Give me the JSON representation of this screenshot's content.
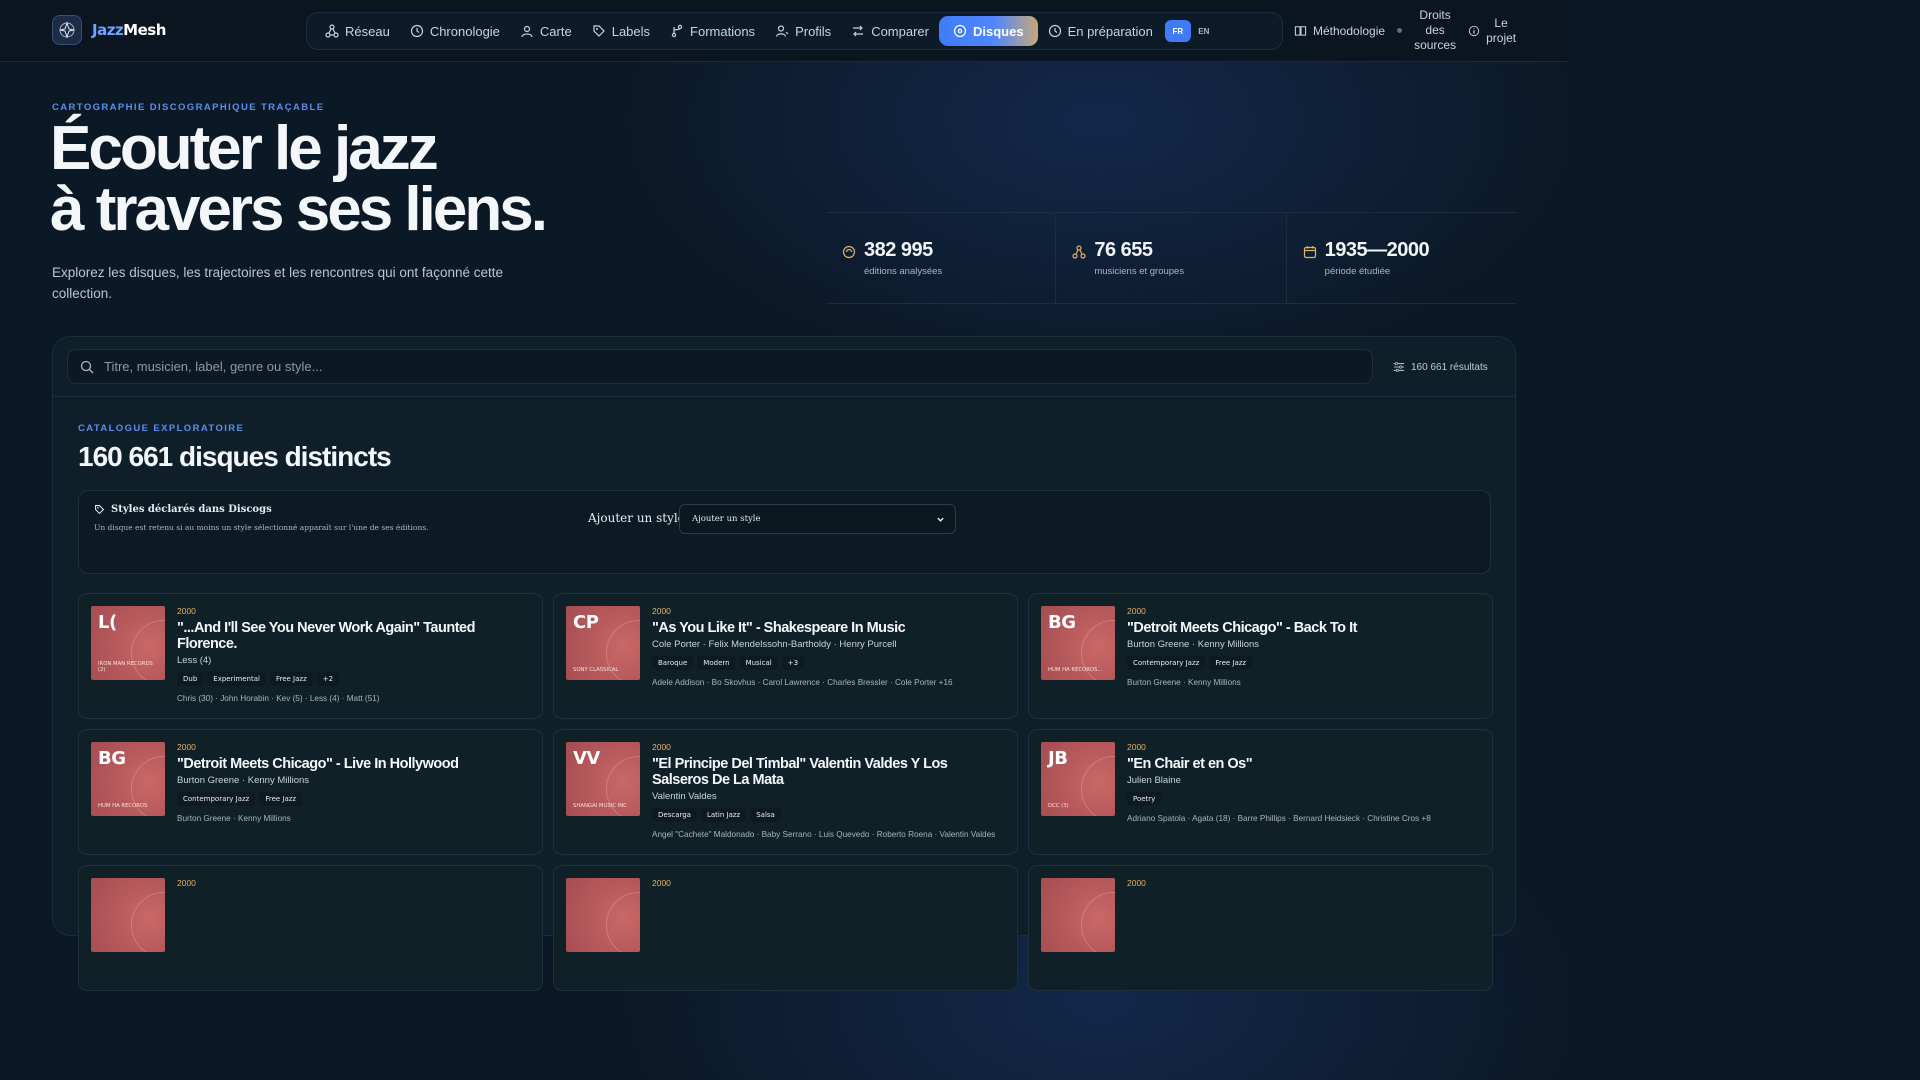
{
  "brand": {
    "name_a": "Jazz",
    "name_b": "Mesh"
  },
  "nav": {
    "items": [
      {
        "label": "Réseau",
        "icon": "network-icon"
      },
      {
        "label": "Chronologie",
        "icon": "clock-icon"
      },
      {
        "label": "Carte",
        "icon": "map-pin-icon"
      },
      {
        "label": "Labels",
        "icon": "tag-icon"
      },
      {
        "label": "Formations",
        "icon": "branch-icon"
      },
      {
        "label": "Profils",
        "icon": "user-icon"
      },
      {
        "label": "Comparer",
        "icon": "swap-icon"
      },
      {
        "label": "Disques",
        "icon": "disc-icon",
        "active": true
      },
      {
        "label": "En préparation",
        "icon": "clock-icon"
      }
    ],
    "lang_fr": "FR",
    "lang_en": "EN",
    "methodology": "Méthodologie",
    "rights": [
      "Droits",
      "des",
      "sources"
    ],
    "project": [
      "Le",
      "projet"
    ]
  },
  "hero": {
    "eyebrow": "CARTOGRAPHIE DISCOGRAPHIQUE TRAÇABLE",
    "title_line1": "Écouter le jazz",
    "title_line2": "à travers ses liens.",
    "subtitle": "Explorez les disques, les trajectoires et les rencontres qui ont façonné cette collection."
  },
  "stats": [
    {
      "value": "382 995",
      "label": "éditions analysées",
      "icon": "disc-icon"
    },
    {
      "value": "76 655",
      "label": "musiciens et groupes",
      "icon": "network-icon"
    },
    {
      "value": "1935—2000",
      "label": "période étudiée",
      "icon": "calendar-icon"
    }
  ],
  "search": {
    "placeholder": "Titre, musicien, label, genre ou style...",
    "results": "160 661 résultats"
  },
  "catalog": {
    "eyebrow": "CATALOGUE EXPLORATOIRE",
    "title": "160 661 disques distincts"
  },
  "filter": {
    "heading": "Styles déclarés dans Discogs",
    "description": "Un disque est retenu si au moins un style sélectionné apparaît sur l'une de ses éditions.",
    "label": "Ajouter un style",
    "selected": "Ajouter un style"
  },
  "cards": [
    {
      "initials": "L(",
      "label": "IRON MAN RECORDS (2)",
      "year": "2000",
      "title": "\"...And I'll See You Never Work Again\" Taunted Florence.",
      "artist": "Less (4)",
      "tags": [
        "Dub",
        "Experimental",
        "Free Jazz",
        "+2"
      ],
      "people": "Chris (30) · John Horabin · Kev (5) · Less (4) · Matt (51)"
    },
    {
      "initials": "CP",
      "label": "SONY CLASSICAL",
      "year": "2000",
      "title": "\"As You Like It\" - Shakespeare In Music",
      "artist": "Cole Porter · Felix Mendelssohn-Bartholdy · Henry Purcell",
      "tags": [
        "Baroque",
        "Modern",
        "Musical",
        "+3"
      ],
      "people": "Adele Addison · Bo Skovhus · Carol Lawrence · Charles Bressler · Cole Porter +16"
    },
    {
      "initials": "BG",
      "label": "HUM HA RECORDS...",
      "year": "2000",
      "title": "\"Detroit Meets Chicago\" - Back To It",
      "artist": "Burton Greene · Kenny Millions",
      "tags": [
        "Contemporary Jazz",
        "Free Jazz"
      ],
      "people": "Burton Greene · Kenny Millions"
    },
    {
      "initials": "BG",
      "label": "HUM HA RECORDS",
      "year": "2000",
      "title": "\"Detroit Meets Chicago\" - Live In Hollywood",
      "artist": "Burton Greene · Kenny Millions",
      "tags": [
        "Contemporary Jazz",
        "Free Jazz"
      ],
      "people": "Burton Greene · Kenny Millions"
    },
    {
      "initials": "VV",
      "label": "SHANGAI MUSIC INC",
      "year": "2000",
      "title": "\"El Principe Del Timbal\" Valentin Valdes Y Los Salseros De La Mata",
      "artist": "Valentin Valdes",
      "tags": [
        "Descarga",
        "Latin Jazz",
        "Salsa"
      ],
      "people": "Angel \"Cachete\" Maldonado · Baby Serrano · Luis Quevedo · Roberto Roena · Valentin Valdes"
    },
    {
      "initials": "JB",
      "label": "DCC (3)",
      "year": "2000",
      "title": "\"En Chair et en Os\"",
      "artist": "Julien Blaine",
      "tags": [
        "Poetry"
      ],
      "people": "Adriano Spatola · Agata (18) · Barre Phillips · Bernard Heidsieck · Christine Cros +8"
    },
    {
      "initials": "",
      "label": "",
      "year": "2000",
      "title": "",
      "artist": "",
      "tags": [],
      "people": ""
    },
    {
      "initials": "",
      "label": "",
      "year": "2000",
      "title": "",
      "artist": "",
      "tags": [],
      "people": ""
    },
    {
      "initials": "",
      "label": "",
      "year": "2000",
      "title": "",
      "artist": "",
      "tags": [],
      "people": ""
    }
  ],
  "colors": {
    "accent": "#3f7bf6",
    "year": "#e0b463",
    "bg": "#0b1826",
    "cover": "#b85a5c"
  }
}
